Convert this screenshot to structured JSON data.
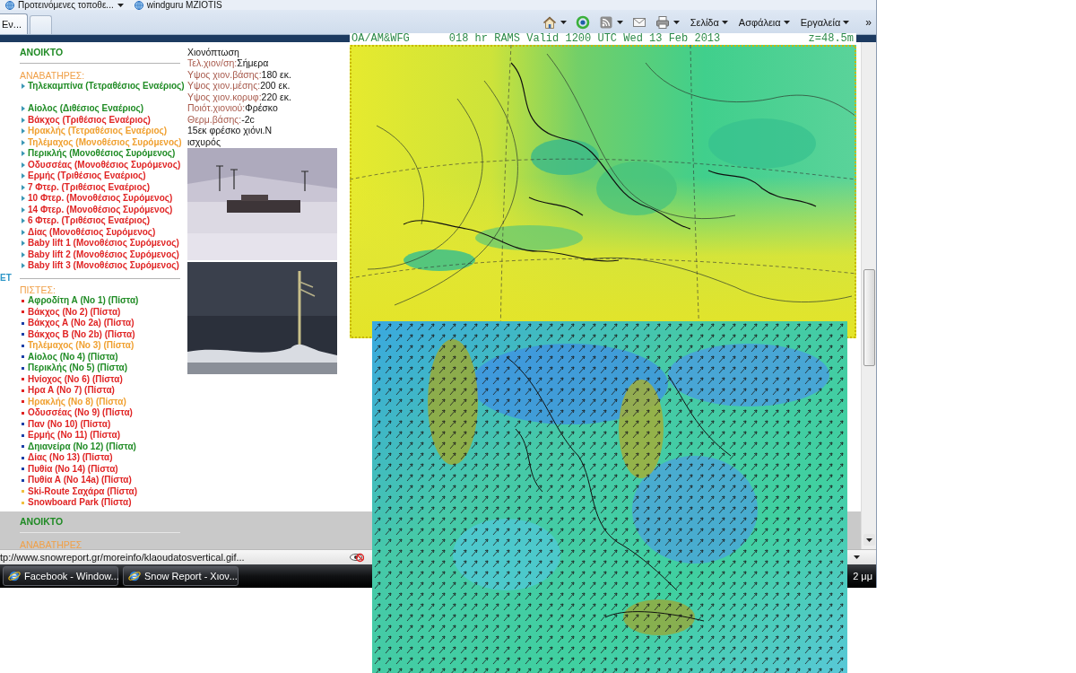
{
  "favorites_bar": {
    "items": [
      {
        "label": "Προτεινόμενες τοποθε...",
        "has_menu": true
      },
      {
        "label": "windguru MZIOTIS",
        "has_menu": false
      }
    ]
  },
  "tabs": [
    {
      "label": "Εν...",
      "selected": true
    }
  ],
  "command_bar": {
    "menus": [
      {
        "label": "Σελίδα"
      },
      {
        "label": "Ασφάλεια"
      },
      {
        "label": "Εργαλεία"
      }
    ],
    "more": "»"
  },
  "page": {
    "edge_text": "ET",
    "resort_blocks": [
      {
        "heading": "ΑΝΟΙΚΤΟ",
        "lifts_title": "ΑΝΑΒΑΤΗΡΕΣ:",
        "lift_groups": [
          {
            "items": [
              {
                "label": "Τηλεκαμπίνα (Τετραθέσιος Εναέριος)",
                "color": "#1f8b24"
              }
            ]
          },
          {
            "items": [
              {
                "label": "Αίολος (Διθέσιος Εναέριος)",
                "color": "#1f8b24"
              },
              {
                "label": "Βάκχος (Τριθέσιος Εναέριος)",
                "color": "#e02424"
              },
              {
                "label": "Ηρακλής (Τετραθέσιος Εναέριος)",
                "color": "#f0a030"
              },
              {
                "label": "Τηλέμαχος (Μονοθέσιος Συρόμενος)",
                "color": "#f0a030"
              },
              {
                "label": "Περικλής (Μονοθέσιος Συρόμενος)",
                "color": "#1f8b24"
              },
              {
                "label": "Οδυσσέας (Μονοθέσιος Συρόμενος)",
                "color": "#e02424"
              },
              {
                "label": "Ερμής (Τριθέσιος Εναέριος)",
                "color": "#e02424"
              },
              {
                "label": "7 Φτερ. (Τριθέσιος Εναέριος)",
                "color": "#e02424"
              },
              {
                "label": "10 Φτερ. (Μονοθέσιος Συρόμενος)",
                "color": "#e02424"
              },
              {
                "label": "14 Φτερ. (Μονοθέσιος Συρόμενος)",
                "color": "#e02424"
              },
              {
                "label": "6 Φτερ. (Τριθέσιος Εναέριος)",
                "color": "#e02424"
              },
              {
                "label": "Δίας (Μονοθέσιος Συρόμενος)",
                "color": "#e02424"
              },
              {
                "label": "Baby lift 1 (Μονοθέσιος Συρόμενος)",
                "color": "#e02424"
              },
              {
                "label": "Baby lift 2 (Μονοθέσιος Συρόμενος)",
                "color": "#e02424"
              },
              {
                "label": "Baby lift 3 (Μονοθέσιος Συρόμενος)",
                "color": "#e02424"
              }
            ]
          }
        ],
        "pistes_title": "ΠΙΣΤΕΣ:",
        "pistes": [
          {
            "label": "Αφροδίτη Α (No 1) (Πίστα)",
            "color": "#1f8b24",
            "marker": {
              "color": "#e02424"
            }
          },
          {
            "label": "Βάκχος (No 2) (Πίστα)",
            "color": "#e02424",
            "marker": {
              "color": "#e02424"
            }
          },
          {
            "label": "Βάκχος Α (No 2a) (Πίστα)",
            "color": "#e02424",
            "marker": {
              "color": "#1c3fa8"
            }
          },
          {
            "label": "Βάκχος Β (No 2b) (Πίστα)",
            "color": "#e02424",
            "marker": {
              "color": "#1c3fa8"
            }
          },
          {
            "label": "Τηλέμαχος (No 3) (Πίστα)",
            "color": "#f0a030",
            "marker": {
              "color": "#1c3fa8"
            }
          },
          {
            "label": "Αίολος (No 4) (Πίστα)",
            "color": "#1f8b24",
            "marker": {
              "color": "#1c3fa8"
            }
          },
          {
            "label": "Περικλής (No 5) (Πίστα)",
            "color": "#1f8b24",
            "marker": {
              "color": "#1c3fa8"
            }
          },
          {
            "label": "Ηνίοχος (No 6) (Πίστα)",
            "color": "#e02424",
            "marker": {
              "color": "#e02424"
            }
          },
          {
            "label": "Ηρα Α (No 7) (Πίστα)",
            "color": "#e02424",
            "marker": {
              "color": "#e02424"
            }
          },
          {
            "label": "Ηρακλής (No 8) (Πίστα)",
            "color": "#f0a030",
            "marker": {
              "color": "#e02424"
            }
          },
          {
            "label": "Οδυσσέας (No 9) (Πίστα)",
            "color": "#e02424",
            "marker": {
              "color": "#e02424"
            }
          },
          {
            "label": "Παν (No 10) (Πίστα)",
            "color": "#e02424",
            "marker": {
              "color": "#1c3fa8"
            }
          },
          {
            "label": "Ερμής (No 11) (Πίστα)",
            "color": "#e02424",
            "marker": {
              "color": "#1c3fa8"
            }
          },
          {
            "label": "Δηιανείρα (No 12) (Πίστα)",
            "color": "#1f8b24",
            "marker": {
              "color": "#1c3fa8"
            }
          },
          {
            "label": "Δίας (No 13) (Πίστα)",
            "color": "#e02424",
            "marker": {
              "color": "#1c3fa8"
            }
          },
          {
            "label": "Πυθία (No 14) (Πίστα)",
            "color": "#e02424",
            "marker": {
              "color": "#1c3fa8"
            }
          },
          {
            "label": "Πυθία Α (No 14a) (Πίστα)",
            "color": "#e02424",
            "marker": {
              "color": "#1c3fa8"
            }
          },
          {
            "label": "Ski-Route Σαχάρα (Πίστα)",
            "color": "#e02424",
            "marker": {
              "color": "#f0c040"
            }
          },
          {
            "label": "Snowboard Park (Πίστα)",
            "color": "#e02424",
            "marker": {
              "color": "#f0c040"
            }
          }
        ]
      },
      {
        "heading": "ΑΝΟΙΚΤΟ",
        "lifts_title": "ΑΝΑΒΑΤΗΡΕΣ"
      }
    ],
    "snow_report": {
      "title": "Χιονόπτωση",
      "rows": [
        {
          "label": "Τελ.χιον/ση:",
          "value": "Σήμερα"
        },
        {
          "label": "Υψος χιον.βάσης:",
          "value": "180 εκ."
        },
        {
          "label": "Υψος χιον.μέσης:",
          "value": "200 εκ."
        },
        {
          "label": "Υψος χιον.κορυφ:",
          "value": "220 εκ."
        },
        {
          "label": "Ποιότ.χιονιού:",
          "value": "Φρέσκο"
        },
        {
          "label": "Θερμ.βάσης:",
          "value": "-2c"
        }
      ],
      "note": "15εκ φρέσκο χιόνι.Ν ισχυρός",
      "webcams": [
        {
          "kind": "day"
        },
        {
          "kind": "night"
        }
      ]
    }
  },
  "maps": [
    {
      "kind": "pressure",
      "caption_parts": [
        "OA/AM&WFG",
        "018 hr RAMS Valid 1200 UTC Wed 13 Feb 2013",
        "z=48.5m"
      ]
    },
    {
      "kind": "wind"
    }
  ],
  "status_bar": {
    "url": "tp://www.snowreport.gr/moreinfo/klaoudatosvertical.gif..."
  },
  "taskbar": {
    "buttons": [
      {
        "label": "Facebook - Window..."
      },
      {
        "label": "Snow Report - Χιον..."
      }
    ],
    "clock": "2 μμ"
  }
}
